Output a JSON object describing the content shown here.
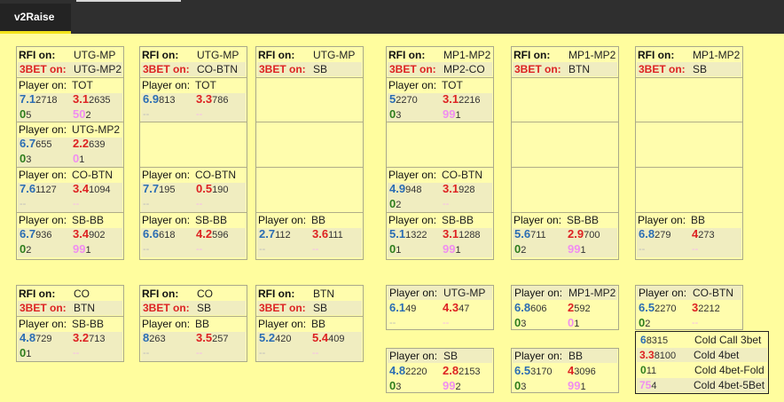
{
  "tab": {
    "label": "v2Raise"
  },
  "labels": {
    "rfi": "RFI on:",
    "bet3": "3BET on:",
    "player": "Player on:",
    "dash": "--"
  },
  "boxes": [
    {
      "rfi": "UTG-MP",
      "bet3": "UTG-MP2",
      "players": [
        {
          "pos": "TOT",
          "s": [
            [
              "7.1",
              "2718"
            ],
            [
              "3.1",
              "2635"
            ],
            [
              "0",
              "5"
            ],
            [
              "50",
              "2"
            ]
          ]
        },
        {
          "pos": "UTG-MP2",
          "s": [
            [
              "6.7",
              "655"
            ],
            [
              "2.2",
              "639"
            ],
            [
              "0",
              "3"
            ],
            [
              "0",
              "1"
            ]
          ]
        },
        {
          "pos": "CO-BTN",
          "s": [
            [
              "7.6",
              "1127"
            ],
            [
              "3.4",
              "1094"
            ],
            [
              "--",
              ""
            ],
            [
              "--",
              ""
            ]
          ]
        },
        {
          "pos": "SB-BB",
          "s": [
            [
              "6.7",
              "936"
            ],
            [
              "3.4",
              "902"
            ],
            [
              "0",
              "2"
            ],
            [
              "99",
              "1"
            ]
          ]
        }
      ]
    },
    {
      "rfi": "UTG-MP",
      "bet3": "CO-BTN",
      "players": [
        {
          "pos": "TOT",
          "s": [
            [
              "6.9",
              "813"
            ],
            [
              "3.3",
              "786"
            ],
            [
              "--",
              ""
            ],
            [
              "--",
              ""
            ]
          ]
        },
        null,
        {
          "pos": "CO-BTN",
          "s": [
            [
              "7.7",
              "195"
            ],
            [
              "0.5",
              "190"
            ],
            [
              "--",
              ""
            ],
            [
              "--",
              ""
            ]
          ]
        },
        {
          "pos": "SB-BB",
          "s": [
            [
              "6.6",
              "618"
            ],
            [
              "4.2",
              "596"
            ],
            [
              "--",
              ""
            ],
            [
              "--",
              ""
            ]
          ]
        }
      ]
    },
    {
      "rfi": "UTG-MP",
      "bet3": "SB",
      "players": [
        null,
        null,
        null,
        {
          "pos": "BB",
          "s": [
            [
              "2.7",
              "112"
            ],
            [
              "3.6",
              "111"
            ],
            [
              "--",
              ""
            ],
            [
              "--",
              ""
            ]
          ]
        }
      ]
    },
    {
      "rfi": "MP1-MP2",
      "bet3": "MP2-CO",
      "players": [
        {
          "pos": "TOT",
          "s": [
            [
              "5",
              "2270"
            ],
            [
              "3.1",
              "2216"
            ],
            [
              "0",
              "3"
            ],
            [
              "99",
              "1"
            ]
          ]
        },
        null,
        {
          "pos": "CO-BTN",
          "s": [
            [
              "4.9",
              "948"
            ],
            [
              "3.1",
              "928"
            ],
            [
              "0",
              "2"
            ],
            [
              "--",
              ""
            ]
          ]
        },
        {
          "pos": "SB-BB",
          "s": [
            [
              "5.1",
              "1322"
            ],
            [
              "3.1",
              "1288"
            ],
            [
              "0",
              "1"
            ],
            [
              "99",
              "1"
            ]
          ]
        }
      ]
    },
    {
      "rfi": "MP1-MP2",
      "bet3": "BTN",
      "players": [
        null,
        null,
        null,
        {
          "pos": "SB-BB",
          "s": [
            [
              "5.6",
              "711"
            ],
            [
              "2.9",
              "700"
            ],
            [
              "0",
              "2"
            ],
            [
              "99",
              "1"
            ]
          ]
        }
      ]
    },
    {
      "rfi": "MP1-MP2",
      "bet3": "SB",
      "players": [
        null,
        null,
        null,
        {
          "pos": "BB",
          "s": [
            [
              "6.8",
              "279"
            ],
            [
              "4",
              "273"
            ],
            [
              "--",
              ""
            ],
            [
              "--",
              ""
            ]
          ]
        }
      ]
    },
    {
      "rfi": "CO",
      "bet3": "BTN",
      "players": [
        {
          "pos": "SB-BB",
          "s": [
            [
              "4.8",
              "729"
            ],
            [
              "3.2",
              "713"
            ],
            [
              "0",
              "1"
            ],
            [
              "--",
              ""
            ]
          ]
        }
      ]
    },
    {
      "rfi": "CO",
      "bet3": "SB",
      "players": [
        {
          "pos": "BB",
          "s": [
            [
              "8",
              "263"
            ],
            [
              "3.5",
              "257"
            ],
            [
              "--",
              ""
            ],
            [
              "--",
              ""
            ]
          ]
        }
      ]
    },
    {
      "rfi": "BTN",
      "bet3": "SB",
      "players": [
        {
          "pos": "BB",
          "s": [
            [
              "5.2",
              "420"
            ],
            [
              "5.4",
              "409"
            ],
            [
              "--",
              ""
            ],
            [
              "--",
              ""
            ]
          ]
        }
      ]
    }
  ],
  "small_boxes": [
    {
      "pos": "UTG-MP",
      "s": [
        [
          "6.1",
          "49"
        ],
        [
          "4.3",
          "47"
        ],
        [
          "--",
          ""
        ],
        [
          "--",
          ""
        ]
      ]
    },
    {
      "pos": "MP1-MP2",
      "s": [
        [
          "6.8",
          "606"
        ],
        [
          "2",
          "592"
        ],
        [
          "0",
          "3"
        ],
        [
          "0",
          "1"
        ]
      ]
    },
    {
      "pos": "CO-BTN",
      "s": [
        [
          "6.5",
          "2270"
        ],
        [
          "3",
          "2212"
        ],
        [
          "0",
          "2"
        ],
        [
          "--",
          ""
        ]
      ]
    },
    {
      "pos": "SB",
      "s": [
        [
          "4.8",
          "2220"
        ],
        [
          "2.8",
          "2153"
        ],
        [
          "0",
          "3"
        ],
        [
          "99",
          "2"
        ]
      ]
    },
    {
      "pos": "BB",
      "s": [
        [
          "6.5",
          "3170"
        ],
        [
          "4",
          "3096"
        ],
        [
          "0",
          "3"
        ],
        [
          "99",
          "1"
        ]
      ]
    }
  ],
  "legend": [
    {
      "num": "6",
      "sub": "8315",
      "label": "Cold Call 3bet",
      "color": "#2b6db3"
    },
    {
      "num": "3.3",
      "sub": "8100",
      "label": "Cold 4bet",
      "color": "#dd2222"
    },
    {
      "num": "0",
      "sub": "11",
      "label": "Cold 4bet-Fold",
      "color": "#2e7d1d"
    },
    {
      "num": "75",
      "sub": "4",
      "label": "Cold 4bet-5Bet",
      "color": "#f08ef0"
    }
  ]
}
